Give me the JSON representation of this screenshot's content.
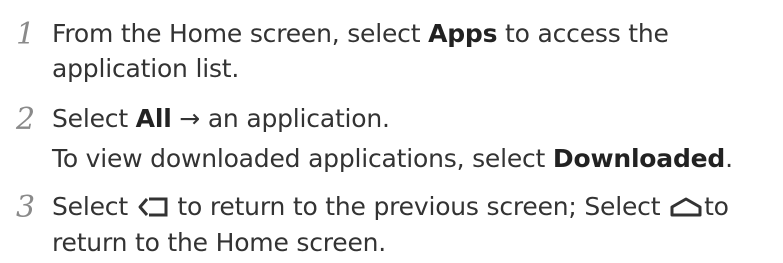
{
  "steps": [
    {
      "number": "1",
      "line1": {
        "pre": "From the Home screen, select ",
        "bold": "Apps",
        "post": " to access the"
      },
      "line2": "application list."
    },
    {
      "number": "2",
      "line1": {
        "pre": "Select ",
        "bold": "All",
        "arrow": " → ",
        "post": "an application."
      },
      "line2": {
        "pre": "To view downloaded applications, select ",
        "bold": "Downloaded",
        "post": "."
      }
    },
    {
      "number": "3",
      "line1": {
        "pre": "Select ",
        "back_icon": "back-icon",
        "mid": " to return to the previous screen; Select ",
        "home_icon": "home-icon",
        "post": "to"
      },
      "line2": "return to the Home screen."
    }
  ],
  "colors": {
    "text": "#333333",
    "step_number": "#8a8a8a"
  }
}
